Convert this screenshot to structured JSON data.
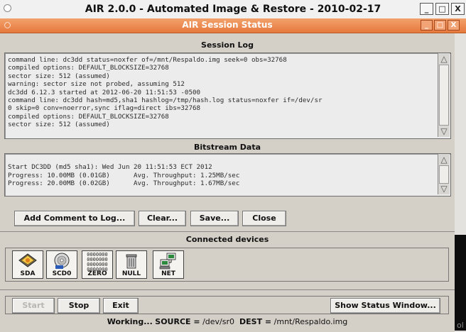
{
  "outer_window": {
    "title": "AIR 2.0.0 - Automated Image & Restore - 2010-02-17",
    "controls": {
      "minimize": "_",
      "maximize": "□",
      "close": "X"
    },
    "right_edge_glyph": "ol"
  },
  "session_window": {
    "title": "AIR Session Status",
    "controls": {
      "minimize": "_",
      "maximize": "□",
      "close": "X"
    }
  },
  "session_log": {
    "heading": "Session Log",
    "lines": [
      "command line: dc3dd status=noxfer of=/mnt/Respaldo.img seek=0 obs=32768",
      "compiled options: DEFAULT_BLOCKSIZE=32768",
      "sector size: 512 (assumed)",
      "warning: sector size not probed, assuming 512",
      "dc3dd 6.12.3 started at 2012-06-20 11:51:53 -0500",
      "command line: dc3dd hash=md5,sha1 hashlog=/tmp/hash.log status=noxfer if=/dev/sr",
      "0 skip=0 conv=noerror,sync iflag=direct ibs=32768",
      "compiled options: DEFAULT_BLOCKSIZE=32768",
      "sector size: 512 (assumed)"
    ]
  },
  "bitstream_data": {
    "heading": "Bitstream Data",
    "lines": [
      "",
      "Start DC3DD (md5 sha1): Wed Jun 20 11:51:53 ECT 2012",
      "Progress: 10.00MB (0.01GB)      Avg. Throughput: 1.25MB/sec",
      "Progress: 20.00MB (0.02GB)      Avg. Throughput: 1.67MB/sec"
    ]
  },
  "log_buttons": {
    "add_comment": "Add Comment to Log...",
    "clear": "Clear...",
    "save": "Save...",
    "close": "Close"
  },
  "connected_devices": {
    "heading": "Connected devices",
    "devices": [
      {
        "label": "SDA",
        "icon": "hard-disk-icon"
      },
      {
        "label": "SCD0",
        "icon": "optical-disc-icon"
      },
      {
        "label": "ZERO",
        "icon": "zeros-pattern-icon"
      },
      {
        "label": "NULL",
        "icon": "trash-can-icon"
      },
      {
        "label": "NET",
        "icon": "network-computers-icon"
      }
    ],
    "zero_pattern": "0000000"
  },
  "controls": {
    "start": "Start",
    "stop": "Stop",
    "exit": "Exit",
    "show_status": "Show Status Window..."
  },
  "status_bar": {
    "working": "Working...",
    "source_label": "SOURCE =",
    "source": "/dev/sr0",
    "dest_label": "DEST =",
    "dest": "/mnt/Respaldo.img"
  },
  "colors": {
    "session_titlebar": "#e6793d",
    "window_background": "#d4d0c8",
    "log_background": "#ececec"
  }
}
